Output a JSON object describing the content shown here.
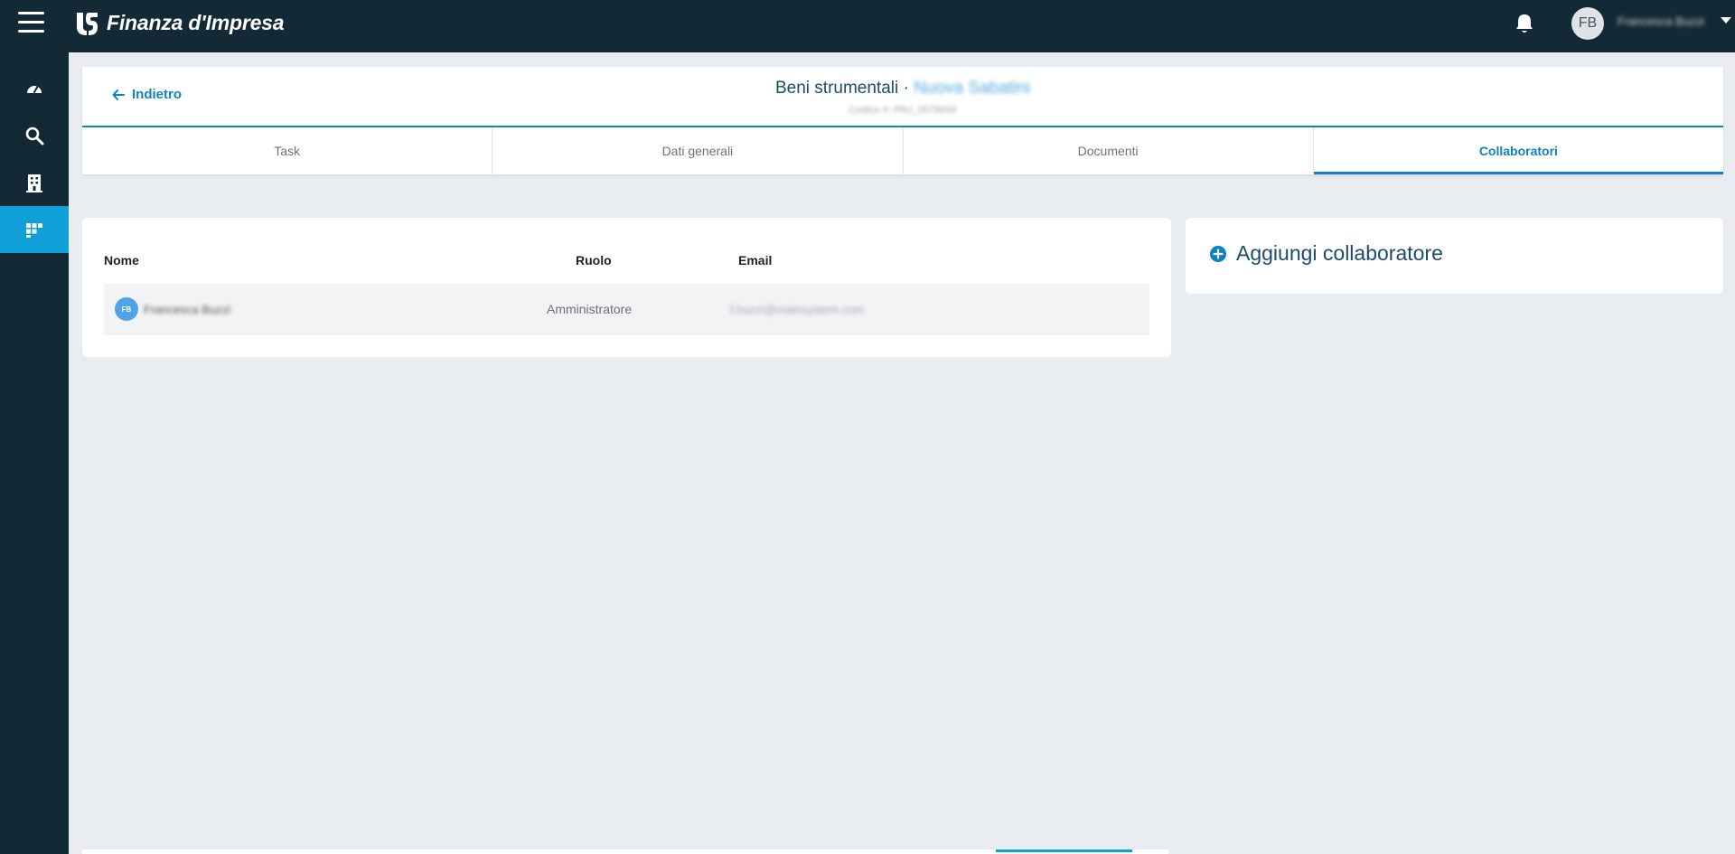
{
  "app": {
    "brand_name": "Finanza d'Impresa",
    "user_initials": "FB",
    "user_name": "Francesca Buzzi"
  },
  "icons": {
    "menu": "hamburger-icon",
    "bell": "bell-icon",
    "caret": "caret-down-icon",
    "back": "arrow-left-icon",
    "add": "plus-circle-icon"
  },
  "colors": {
    "topbar": "#132a36",
    "accent": "#0fa0d8",
    "link": "#0d82bf",
    "background": "#e9edf1"
  },
  "sidebar": {
    "items": [
      {
        "name": "dashboard",
        "icon": "speedometer-icon"
      },
      {
        "name": "search",
        "icon": "search-icon"
      },
      {
        "name": "companies",
        "icon": "building-icon"
      },
      {
        "name": "projects",
        "icon": "grid-icon",
        "active": true
      }
    ]
  },
  "header": {
    "back_label": "Indietro",
    "title": "Beni strumentali · ",
    "title_client": "Nuova Sabatini",
    "subtitle": "Codice #: PRJ_0578934",
    "tabs": [
      {
        "label": "Task",
        "active": false
      },
      {
        "label": "Dati generali",
        "active": false
      },
      {
        "label": "Documenti",
        "active": false
      },
      {
        "label": "Collaboratori",
        "active": true
      }
    ]
  },
  "collaborators": {
    "columns": {
      "name": "Nome",
      "role": "Ruolo",
      "email": "Email"
    },
    "rows": [
      {
        "initials": "FB",
        "name": "Francesca Buzzi",
        "role": "Amministratore",
        "email": "f.buzzi@mainsystem.com"
      }
    ]
  },
  "add_card": {
    "label": "Aggiungi collaboratore"
  }
}
